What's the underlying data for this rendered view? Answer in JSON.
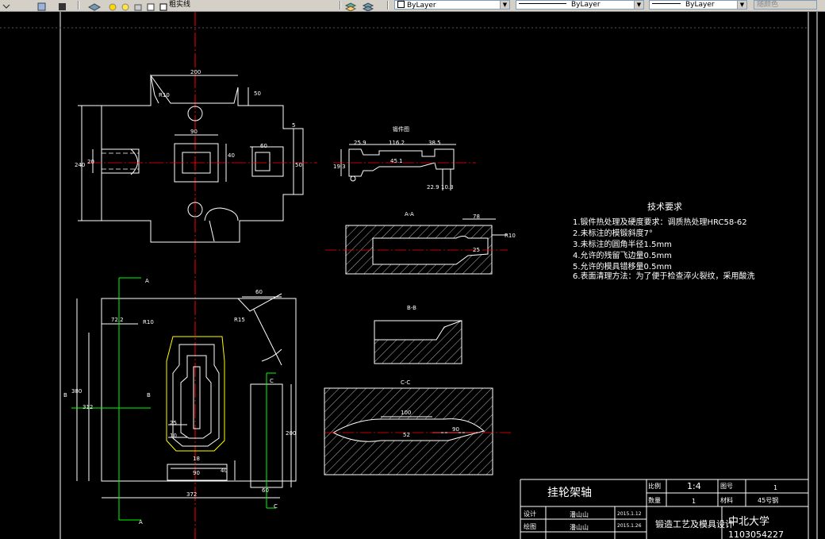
{
  "toolbar": {
    "linetype_label": "粗实线",
    "color_value": "ByLayer",
    "linetype_value": "ByLayer",
    "lineweight_value": "ByLayer",
    "plotstyle_value": "随颜色"
  },
  "colors": {
    "background": "#000000",
    "outline": "#ffffff",
    "centerline": "#ff0000",
    "section_line": "#00ff00",
    "yellow_contour": "#ffff00"
  },
  "drawing": {
    "plan_view": {
      "dims": {
        "d200": "200",
        "d50": "50",
        "d5": "5",
        "r10": "R10",
        "d90": "90",
        "d60": "60",
        "d240": "240",
        "d40": "40",
        "d20": "20",
        "d50b": "50"
      }
    },
    "forging_view": {
      "title": "锻件图",
      "dims": {
        "a": "25.9",
        "b": "116.2",
        "c": "38.5",
        "d": "19.3",
        "e": "45.1",
        "f": "22.9",
        "g": "10.3"
      }
    },
    "section_aa": {
      "title": "A-A",
      "dims": {
        "r10": "R10",
        "d78": "78",
        "d25": "25"
      }
    },
    "section_bb": {
      "title": "B-B"
    },
    "section_cc": {
      "title": "C-C",
      "dims": {
        "d100": "100",
        "d90": "90",
        "d52": "52"
      }
    },
    "lower_view": {
      "markers": {
        "a": "A",
        "b": "B",
        "c": "C"
      },
      "dims": {
        "d60": "60",
        "d72": "72.2",
        "r10": "R10",
        "r15": "R15",
        "d380": "380",
        "d312": "312",
        "d25": "25",
        "d10": "10",
        "d90": "90",
        "d372": "372",
        "d60b": "60",
        "d200": "200",
        "d40": "40",
        "d18": "18"
      }
    }
  },
  "tech_requirements": {
    "title": "技术要求",
    "lines": [
      "1.锻件热处理及硬度要求：调质热处理HRC58-62",
      "2.未标注的模锻斜度7°",
      "3.未标注的圆角半径1.5mm",
      "4.允许的残留飞边量0.5mm",
      "5.允许的模具错移量0.5mm",
      "6.表面清理方法：为了便于检查淬火裂纹，采用酸洗"
    ]
  },
  "title_block": {
    "part_name": "挂轮架轴",
    "scale_label": "比例",
    "scale_value": "1:4",
    "drawing_no_label": "图号",
    "drawing_no_value": "1",
    "quantity_label": "数量",
    "quantity_value": "1",
    "material_label": "材料",
    "material_value": "45号钢",
    "design_label": "设计",
    "design_name": "潘山山",
    "design_date": "2015.1.12",
    "drawing_label": "绘图",
    "drawing_name": "潘山山",
    "drawing_date": "2015.1.26",
    "course": "锻造工艺及模具设计",
    "school": "中北大学",
    "student_id": "1103054227"
  }
}
